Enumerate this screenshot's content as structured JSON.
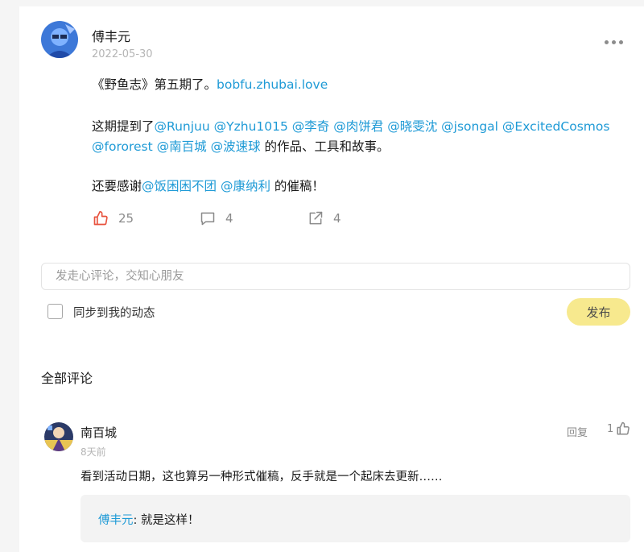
{
  "post": {
    "author": "傅丰元",
    "date": "2022-05-30",
    "line1_text": "《野鱼志》第五期了。",
    "line1_link": "bobfu.zhubai.love",
    "line2_prefix": "这期提到了",
    "line2_mentions": [
      "@Runjuu",
      "@Yzhu1015",
      "@李奇",
      "@肉饼君",
      "@晓雯沈",
      "@jsongal",
      "@ExcitedCosmos"
    ],
    "line3_mentions": [
      "@fororest",
      "@南百城",
      "@波速球"
    ],
    "line3_suffix": " 的作品、工具和故事。",
    "line4_prefix": "还要感谢",
    "line4_mentions": [
      "@饭困困不团",
      "@康纳利"
    ],
    "line4_suffix": " 的催稿！",
    "likes": "25",
    "comments": "4",
    "shares": "4"
  },
  "composer": {
    "placeholder": "发走心评论，交知心朋友",
    "sync_label": "同步到我的动态",
    "publish_label": "发布"
  },
  "comments_section": {
    "heading": "全部评论"
  },
  "comment": {
    "author": "南百城",
    "time": "8天前",
    "reply_label": "回复",
    "likes": "1",
    "text": "看到活动日期，这也算另一种形式催稿，反手就是一个起床去更新……",
    "quote_author": "傅丰元",
    "quote_text": ": 就是这样！"
  },
  "colors": {
    "link": "#1e9ad6",
    "like_icon": "#e8533f",
    "publish_button": "#f7e98e"
  }
}
